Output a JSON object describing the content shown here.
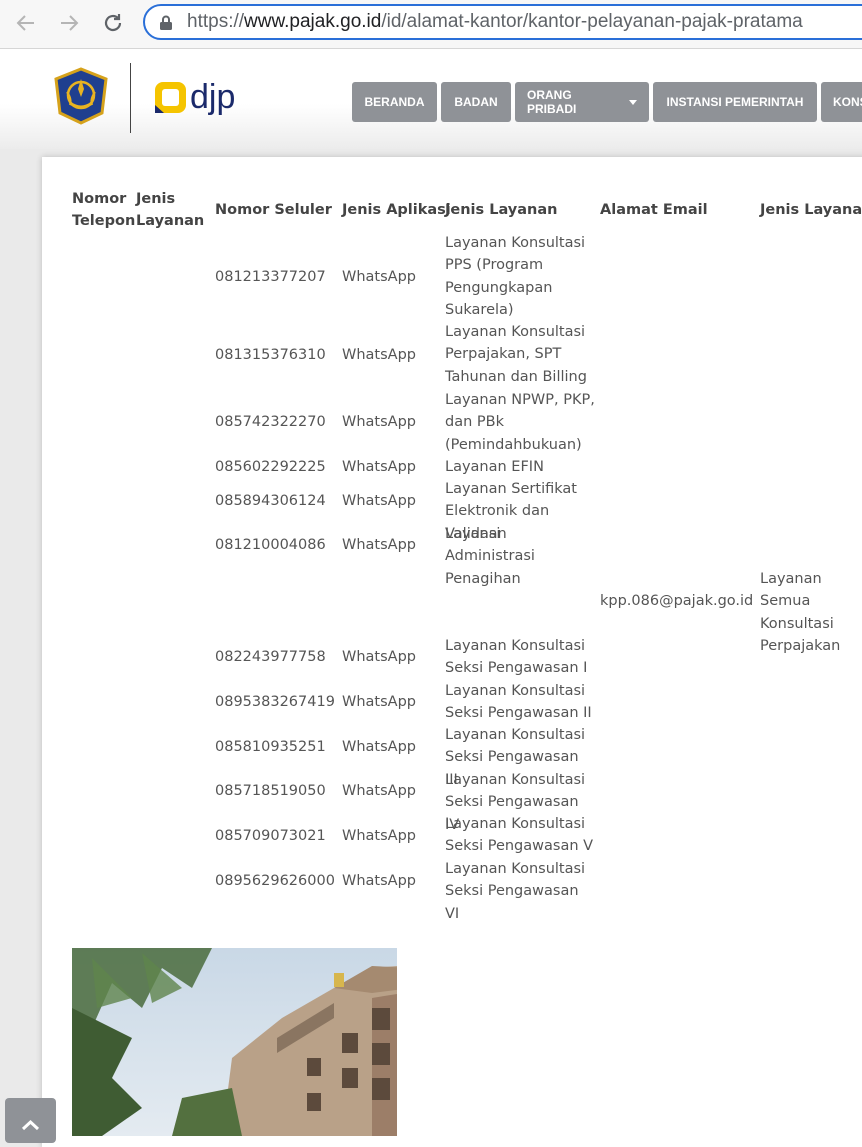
{
  "browser": {
    "url_prefix": "https://",
    "url_domain": "www.pajak.go.id",
    "url_path": "/id/alamat-kantor/kantor-pelayanan-pajak-pratama"
  },
  "header": {
    "logo_text": "djp",
    "menu": [
      "BERANDA",
      "BADAN",
      "ORANG PRIBADI",
      "INSTANSI PEMERINTAH",
      "KONS"
    ]
  },
  "table": {
    "headers": {
      "nomor_telepon": "Nomor Telepon",
      "jenis_layanan_1": "Jenis Layanan",
      "nomor_seluler": "Nomor Seluler",
      "jenis_aplikasi": "Jenis Aplikasi",
      "jenis_layanan_2": "Jenis Layanan",
      "alamat_email": "Alamat Email",
      "jenis_layanan_3": "Jenis Layanan"
    },
    "rows": [
      {
        "seluler": "081213377207",
        "aplikasi": "WhatsApp",
        "layanan": "Layanan Konsultasi PPS (Program Pengungkapan Sukarela)"
      },
      {
        "seluler": "081315376310",
        "aplikasi": "WhatsApp",
        "layanan": "Layanan Konsultasi Perpajakan, SPT Tahunan dan Billing"
      },
      {
        "seluler": "085742322270",
        "aplikasi": "WhatsApp",
        "layanan": "Layanan NPWP, PKP, dan PBk (Pemindahbukuan)"
      },
      {
        "seluler": "085602292225",
        "aplikasi": "WhatsApp",
        "layanan": "Layanan EFIN"
      },
      {
        "seluler": "085894306124",
        "aplikasi": "WhatsApp",
        "layanan": "Layanan Sertifikat Elektronik dan Validasi"
      },
      {
        "seluler": "081210004086",
        "aplikasi": "WhatsApp",
        "layanan": "Layanan Administrasi Penagihan"
      },
      {
        "seluler": "082243977758",
        "aplikasi": "WhatsApp",
        "layanan": "Layanan Konsultasi Seksi Pengawasan I"
      },
      {
        "seluler": "0895383267419",
        "aplikasi": "WhatsApp",
        "layanan": "Layanan Konsultasi Seksi Pengawasan II"
      },
      {
        "seluler": "085810935251",
        "aplikasi": "WhatsApp",
        "layanan": "Layanan Konsultasi Seksi Pengawasan III"
      },
      {
        "seluler": "085718519050",
        "aplikasi": "WhatsApp",
        "layanan": "Layanan Konsultasi Seksi Pengawasan IV"
      },
      {
        "seluler": "085709073021",
        "aplikasi": "WhatsApp",
        "layanan": "Layanan Konsultasi Seksi Pengawasan V"
      },
      {
        "seluler": "0895629626000",
        "aplikasi": "WhatsApp",
        "layanan": "Layanan Konsultasi Seksi Pengawasan VI"
      }
    ],
    "email_row": {
      "email": "kpp.086@pajak.go.id",
      "layanan": "Layanan Semua Konsultasi Perpajakan"
    }
  }
}
